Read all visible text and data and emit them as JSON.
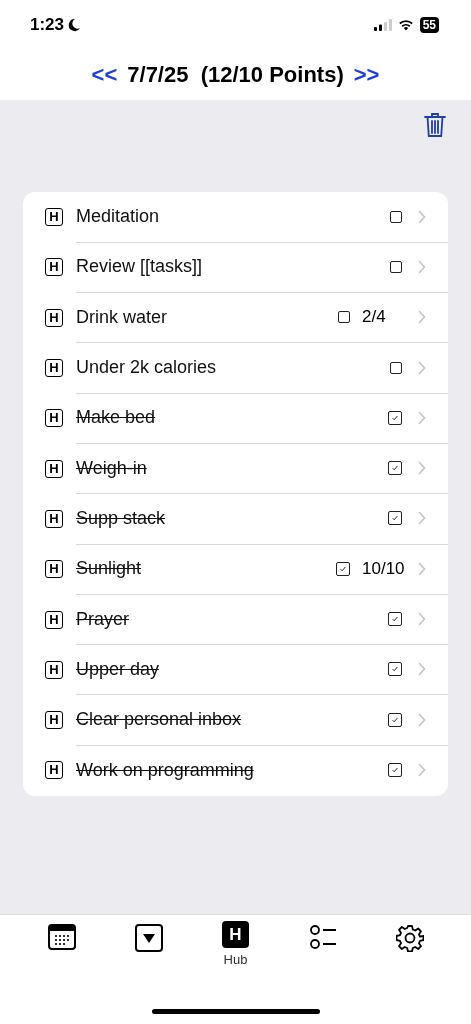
{
  "status_bar": {
    "time": "1:23",
    "battery": "55"
  },
  "header": {
    "prev": "<<",
    "title": "7/7/25  (12/10 Points)",
    "next": ">>"
  },
  "tasks": [
    {
      "badge": "H",
      "title": "Meditation",
      "checked": false
    },
    {
      "badge": "H",
      "title": "Review [[tasks]]",
      "checked": false
    },
    {
      "badge": "H",
      "title": "Drink water",
      "checked": false,
      "count": "2/4"
    },
    {
      "badge": "H",
      "title": "Under 2k calories",
      "checked": false
    },
    {
      "badge": "H",
      "title": "Make bed",
      "checked": true
    },
    {
      "badge": "H",
      "title": "Weigh-in",
      "checked": true
    },
    {
      "badge": "H",
      "title": "Supp stack",
      "checked": true
    },
    {
      "badge": "H",
      "title": "Sunlight",
      "checked": true,
      "count": "10/10"
    },
    {
      "badge": "H",
      "title": "Prayer",
      "checked": true
    },
    {
      "badge": "H",
      "title": "Upper day",
      "checked": true
    },
    {
      "badge": "H",
      "title": "Clear personal inbox",
      "checked": true
    },
    {
      "badge": "H",
      "title": "Work on programming",
      "checked": true
    }
  ],
  "tab_bar": [
    {
      "kind": "calendar",
      "selected": false
    },
    {
      "kind": "dropdown",
      "selected": false
    },
    {
      "kind": "hub",
      "selected": true,
      "letter": "H",
      "label": "Hub"
    },
    {
      "kind": "list",
      "selected": false
    },
    {
      "kind": "settings",
      "selected": false
    }
  ]
}
